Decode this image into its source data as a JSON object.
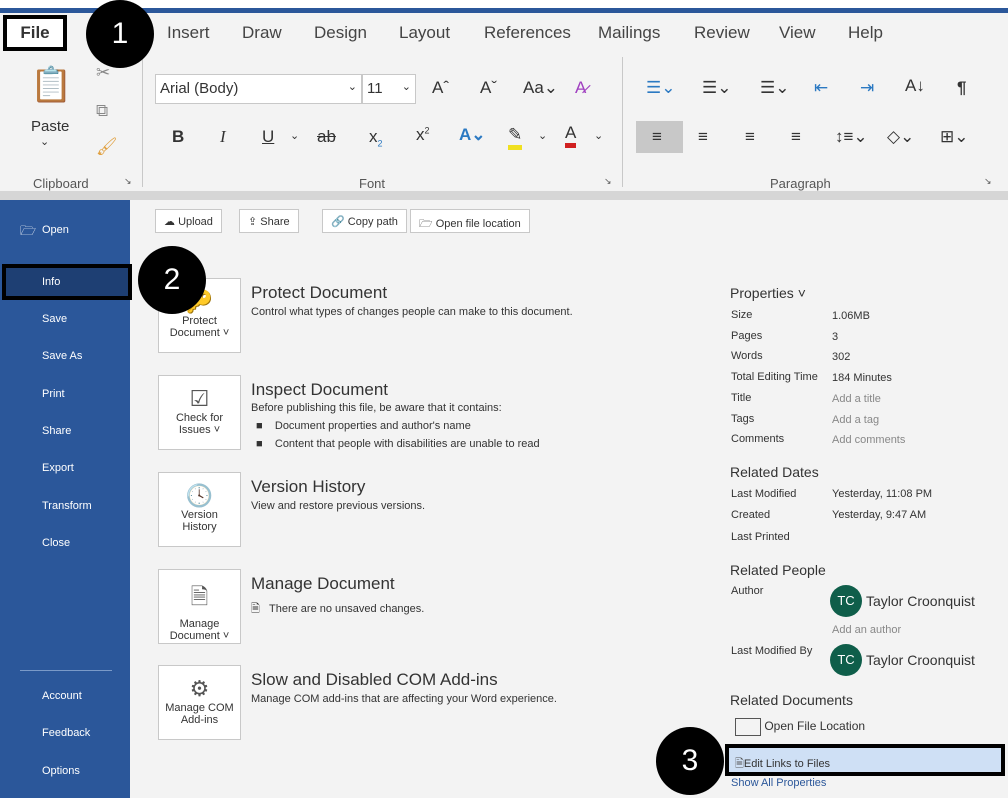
{
  "tabs": [
    "File",
    "Insert",
    "Draw",
    "Design",
    "Layout",
    "References",
    "Mailings",
    "Review",
    "View",
    "Help"
  ],
  "badges": [
    "1",
    "2",
    "3"
  ],
  "ribbon": {
    "clipboard": {
      "paste": "Paste",
      "label": "Clipboard"
    },
    "font": {
      "font_name": "Arial (Body)",
      "font_size": "11",
      "label": "Font"
    },
    "paragraph": {
      "label": "Paragraph"
    }
  },
  "sidebar": {
    "items": [
      "Open",
      "Info",
      "Save",
      "Save As",
      "Print",
      "Share",
      "Export",
      "Transform",
      "Close"
    ],
    "bottom": [
      "Account",
      "Feedback",
      "Options"
    ],
    "selected": "Info"
  },
  "actions": [
    "Upload",
    "Share",
    "Copy path",
    "Open file location"
  ],
  "sections": [
    {
      "button": [
        "Protect",
        "Document ˅"
      ],
      "title": "Protect Document",
      "desc": "Control what types of changes people can make to this document."
    },
    {
      "button": [
        "Check for",
        "Issues ˅"
      ],
      "title": "Inspect Document",
      "desc": "Before publishing this file, be aware that it contains:",
      "bullets": [
        "Document properties and author's name",
        "Content that people with disabilities are unable to read"
      ]
    },
    {
      "button": [
        "Version",
        "History"
      ],
      "title": "Version History",
      "desc": "View and restore previous versions."
    },
    {
      "button": [
        "Manage",
        "Document ˅"
      ],
      "title": "Manage Document",
      "desc": "There are no unsaved changes."
    },
    {
      "button": [
        "Manage COM",
        "Add-ins"
      ],
      "title": "Slow and Disabled COM Add-ins",
      "desc": "Manage COM add-ins that are affecting your Word experience."
    }
  ],
  "properties": {
    "heading": "Properties ˅",
    "rows": [
      [
        "Size",
        "1.06MB"
      ],
      [
        "Pages",
        "3"
      ],
      [
        "Words",
        "302"
      ],
      [
        "Total Editing Time",
        "184 Minutes"
      ],
      [
        "Title",
        "Add a title"
      ],
      [
        "Tags",
        "Add a tag"
      ],
      [
        "Comments",
        "Add comments"
      ]
    ],
    "dates_heading": "Related Dates",
    "dates": [
      [
        "Last Modified",
        "Yesterday, 11:08 PM"
      ],
      [
        "Created",
        "Yesterday, 9:47 AM"
      ],
      [
        "Last Printed",
        ""
      ]
    ],
    "people_heading": "Related People",
    "author_label": "Author",
    "author_initials": "TC",
    "author": "Taylor Croonquist",
    "add_author": "Add an author",
    "modified_by_label": "Last Modified By",
    "modified_initials": "TC",
    "modified_by": "Taylor Croonquist",
    "docs_heading": "Related Documents",
    "open_location": "Open File Location",
    "edit_links": "Edit Links to Files",
    "show_all": "Show All Properties"
  },
  "colors": {
    "accent": "#2b579a",
    "avatar": "#0f5e4a"
  }
}
